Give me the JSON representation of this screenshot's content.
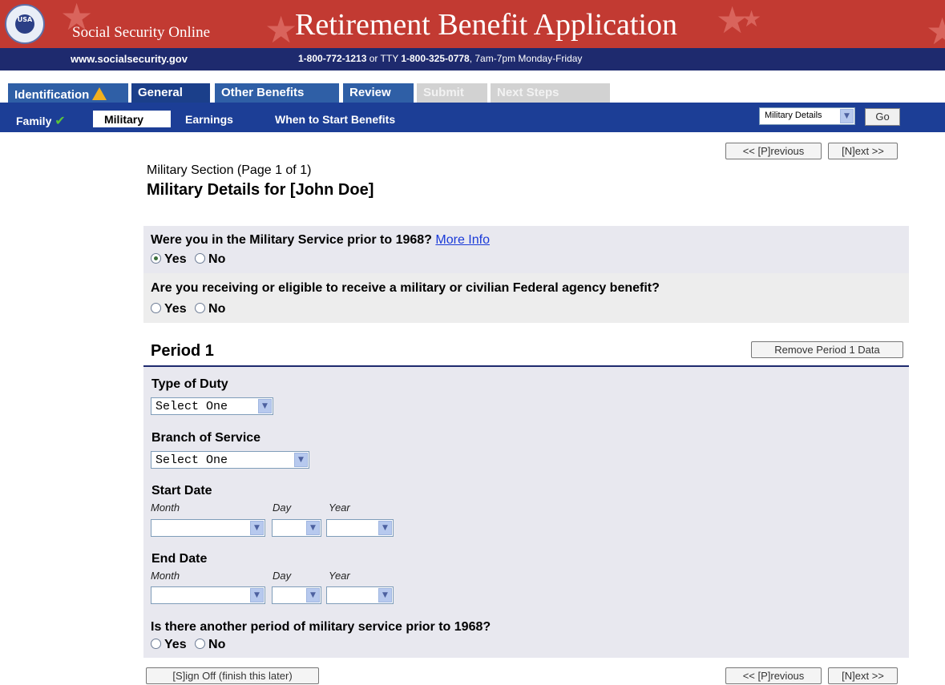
{
  "header": {
    "brand": "Social Security Online",
    "app_title": "Retirement Benefit Application",
    "seal_text": "USA",
    "site": "www.socialsecurity.gov",
    "phone_main": "1-800-772-1213",
    "phone_or": " or TTY ",
    "phone_tty": "1-800-325-0778",
    "phone_hours": ", 7am-7pm Monday-Friday"
  },
  "tabs": {
    "identification": "Identification",
    "general": "General",
    "other_benefits": "Other Benefits",
    "review": "Review",
    "submit": "Submit",
    "next_steps": "Next Steps"
  },
  "subtabs": {
    "family": "Family",
    "military": "Military",
    "earnings": "Earnings",
    "when_to_start": "When to Start Benefits"
  },
  "jump": {
    "selected": "Military Details",
    "go_label": "Go"
  },
  "nav": {
    "previous": "<< [P]revious",
    "next": "[N]ext >>",
    "sign_off": "[S]ign Off (finish this later)"
  },
  "page": {
    "section": "Military Section (Page 1 of 1)",
    "title": "Military Details for [John Doe]"
  },
  "questions": {
    "q1": "Were you in the Military Service prior to 1968?",
    "more_info": "More Info",
    "q1_selected": "Yes",
    "q2": "Are you receiving or eligible to receive a military or civilian Federal agency benefit?",
    "q3": "Is there another period of military service prior to 1968?",
    "yes": "Yes",
    "no": "No"
  },
  "period": {
    "title": "Period 1",
    "remove_label": "Remove Period 1 Data",
    "type_of_duty_label": "Type of Duty",
    "type_of_duty_value": "Select One",
    "branch_label": "Branch of Service",
    "branch_value": "Select One",
    "start_date_label": "Start Date",
    "end_date_label": "End Date",
    "month": "Month",
    "day": "Day",
    "year": "Year"
  },
  "colors": {
    "banner_red": "#c23a32",
    "navy": "#1e2a6e",
    "subnav_blue": "#1c3e96",
    "question_bg": "#e8e8ef",
    "link_blue": "#1a3ad8"
  }
}
